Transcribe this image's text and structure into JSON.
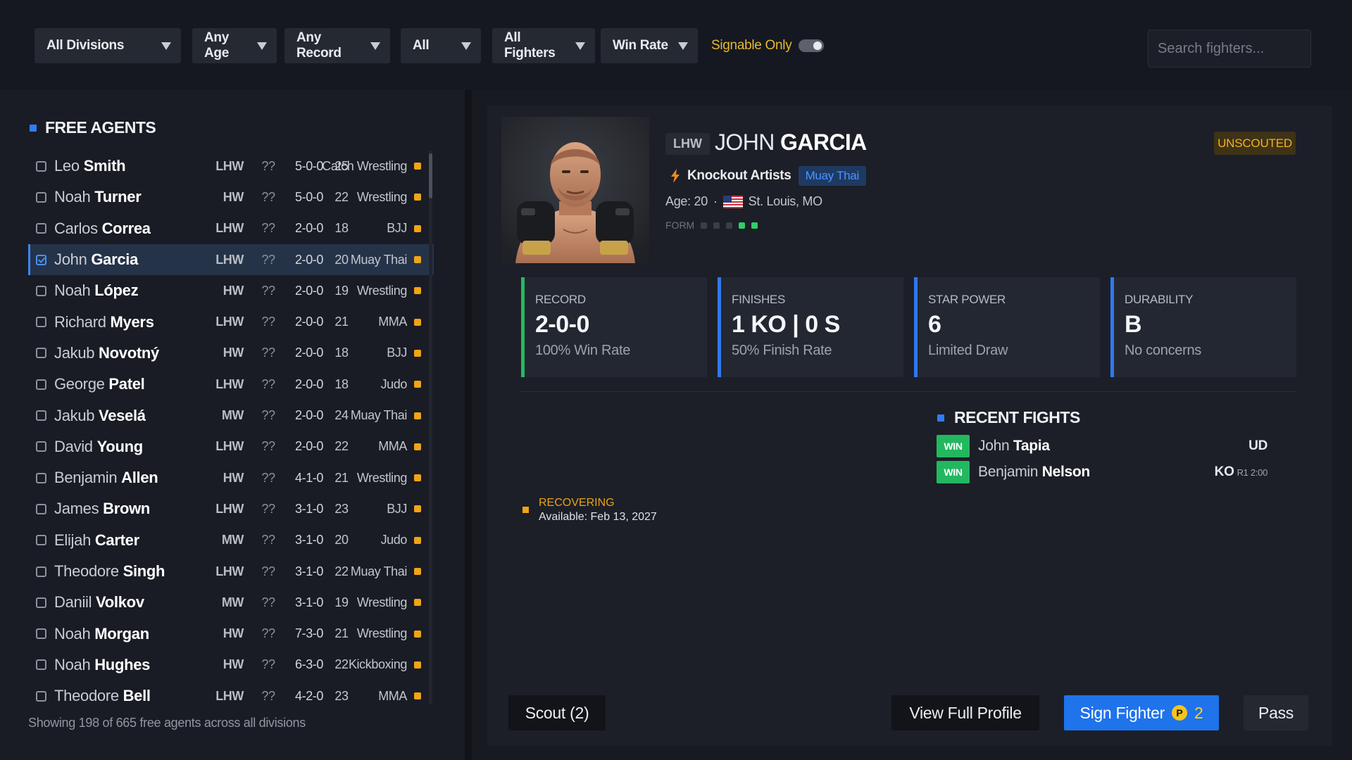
{
  "filters": {
    "division": "All Divisions",
    "age": "Any Age",
    "record": "Any Record",
    "all": "All",
    "fighters": "All Fighters",
    "sort": "Win Rate",
    "signable_label": "Signable Only",
    "search_placeholder": "Search fighters..."
  },
  "list": {
    "title": "FREE AGENTS",
    "footer": "Showing 198 of 665 free agents across all divisions",
    "rows": [
      {
        "first": "Leo",
        "last": "Smith",
        "division": "LHW",
        "rating": "??",
        "record": "5-0-0",
        "age": "25",
        "style": "Catch Wrestling"
      },
      {
        "first": "Noah",
        "last": "Turner",
        "division": "HW",
        "rating": "??",
        "record": "5-0-0",
        "age": "22",
        "style": "Wrestling"
      },
      {
        "first": "Carlos",
        "last": "Correa",
        "division": "LHW",
        "rating": "??",
        "record": "2-0-0",
        "age": "18",
        "style": "BJJ"
      },
      {
        "first": "John",
        "last": "Garcia",
        "division": "LHW",
        "rating": "??",
        "record": "2-0-0",
        "age": "20",
        "style": "Muay Thai"
      },
      {
        "first": "Noah",
        "last": "López",
        "division": "HW",
        "rating": "??",
        "record": "2-0-0",
        "age": "19",
        "style": "Wrestling"
      },
      {
        "first": "Richard",
        "last": "Myers",
        "division": "LHW",
        "rating": "??",
        "record": "2-0-0",
        "age": "21",
        "style": "MMA"
      },
      {
        "first": "Jakub",
        "last": "Novotný",
        "division": "HW",
        "rating": "??",
        "record": "2-0-0",
        "age": "18",
        "style": "BJJ"
      },
      {
        "first": "George",
        "last": "Patel",
        "division": "LHW",
        "rating": "??",
        "record": "2-0-0",
        "age": "18",
        "style": "Judo"
      },
      {
        "first": "Jakub",
        "last": "Veselá",
        "division": "MW",
        "rating": "??",
        "record": "2-0-0",
        "age": "24",
        "style": "Muay Thai"
      },
      {
        "first": "David",
        "last": "Young",
        "division": "LHW",
        "rating": "??",
        "record": "2-0-0",
        "age": "22",
        "style": "MMA"
      },
      {
        "first": "Benjamin",
        "last": "Allen",
        "division": "HW",
        "rating": "??",
        "record": "4-1-0",
        "age": "21",
        "style": "Wrestling"
      },
      {
        "first": "James",
        "last": "Brown",
        "division": "LHW",
        "rating": "??",
        "record": "3-1-0",
        "age": "23",
        "style": "BJJ"
      },
      {
        "first": "Elijah",
        "last": "Carter",
        "division": "MW",
        "rating": "??",
        "record": "3-1-0",
        "age": "20",
        "style": "Judo"
      },
      {
        "first": "Theodore",
        "last": "Singh",
        "division": "LHW",
        "rating": "??",
        "record": "3-1-0",
        "age": "22",
        "style": "Muay Thai"
      },
      {
        "first": "Daniil",
        "last": "Volkov",
        "division": "MW",
        "rating": "??",
        "record": "3-1-0",
        "age": "19",
        "style": "Wrestling"
      },
      {
        "first": "Noah",
        "last": "Morgan",
        "division": "HW",
        "rating": "??",
        "record": "7-3-0",
        "age": "21",
        "style": "Wrestling"
      },
      {
        "first": "Noah",
        "last": "Hughes",
        "division": "HW",
        "rating": "??",
        "record": "6-3-0",
        "age": "22",
        "style": "Kickboxing"
      },
      {
        "first": "Theodore",
        "last": "Bell",
        "division": "LHW",
        "rating": "??",
        "record": "4-2-0",
        "age": "23",
        "style": "MMA"
      }
    ]
  },
  "detail": {
    "division": "LHW",
    "first": "JOHN",
    "last": "GARCIA",
    "status": "UNSCOUTED",
    "archetype": "Knockout Artists",
    "style": "Muay Thai",
    "age_text": "Age: 20",
    "location": "St. Louis, MO",
    "form_label": "FORM",
    "form": [
      0,
      0,
      0,
      1,
      1
    ],
    "stats": [
      {
        "label": "RECORD",
        "value": "2-0-0",
        "sub": "100% Win Rate"
      },
      {
        "label": "FINISHES",
        "value": "1 KO | 0 S",
        "sub": "50% Finish Rate"
      },
      {
        "label": "STAR POWER",
        "value": "6",
        "sub": "Limited Draw"
      },
      {
        "label": "DURABILITY",
        "value": "B",
        "sub": "No concerns"
      }
    ],
    "recent_title": "RECENT FIGHTS",
    "fights": [
      {
        "result": "WIN",
        "first": "John",
        "last": "Tapia",
        "method": "UD",
        "detail": ""
      },
      {
        "result": "WIN",
        "first": "Benjamin",
        "last": "Nelson",
        "method": "KO",
        "detail": "R1 2:00"
      }
    ],
    "recovery_status": "RECOVERING",
    "recovery_date": "Available: Feb 13, 2027"
  },
  "actions": {
    "scout": "Scout (2)",
    "view": "View Full Profile",
    "sign": "Sign Fighter",
    "sign_coin": "P",
    "sign_cost": "2",
    "pass": "Pass"
  },
  "colors": {
    "accent_blue": "#1f73eb",
    "win_green": "#23b760",
    "warning_orange": "#f0a416",
    "unscouted_gold": "#f2b21b"
  }
}
